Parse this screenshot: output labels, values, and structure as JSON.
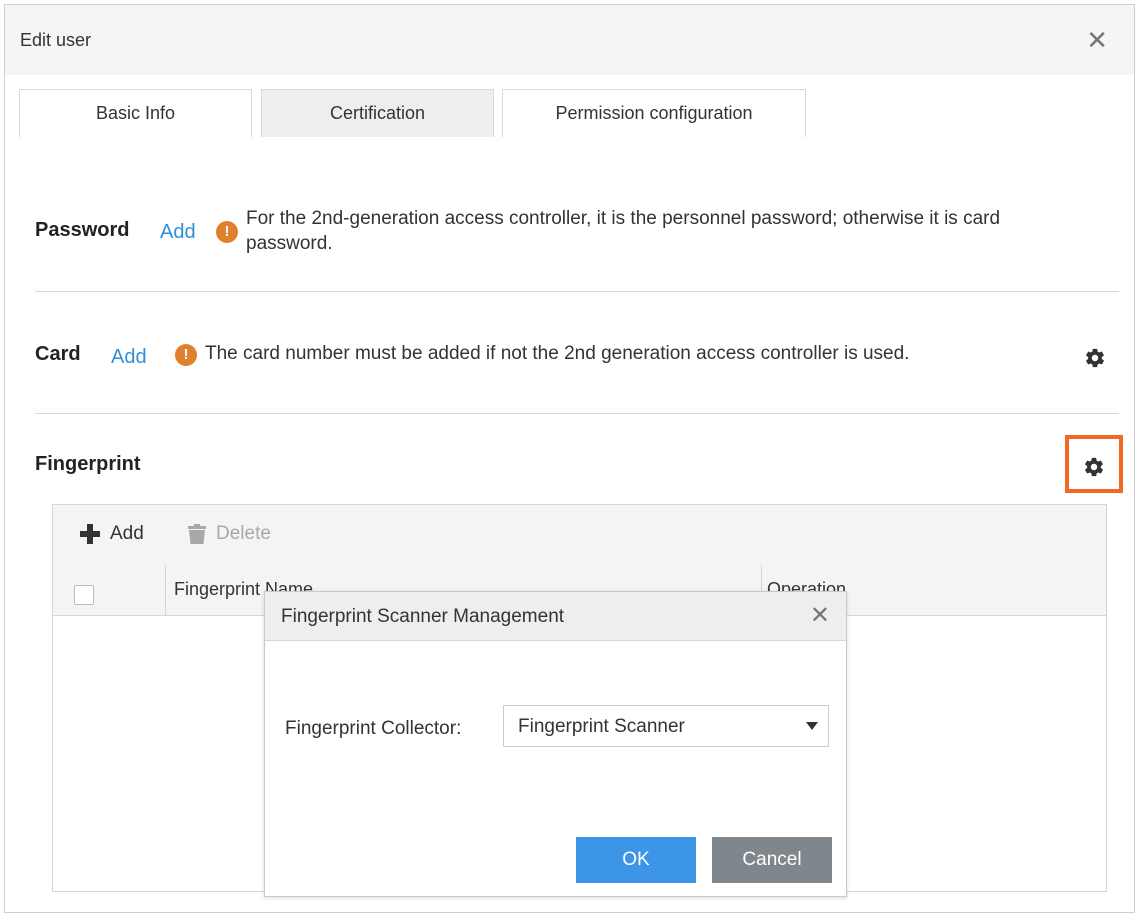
{
  "dialog": {
    "title": "Edit user",
    "close_icon": "close-icon"
  },
  "tabs": [
    {
      "label": "Basic Info",
      "active": false
    },
    {
      "label": "Certification",
      "active": true
    },
    {
      "label": "Permission configuration",
      "active": false
    }
  ],
  "password": {
    "label": "Password",
    "add_label": "Add",
    "note_line1": "For the 2nd-generation access controller, it is the personnel password; otherwise it is card",
    "note_line2": "password."
  },
  "card": {
    "label": "Card",
    "add_label": "Add",
    "note": "The card number must be added if not the 2nd generation access controller is used."
  },
  "fingerprint": {
    "label": "Fingerprint",
    "toolbar": {
      "add_label": "Add",
      "delete_label": "Delete"
    },
    "table": {
      "columns": [
        "Fingerprint Name",
        "Operation"
      ]
    }
  },
  "modal": {
    "title": "Fingerprint Scanner Management",
    "field_label": "Fingerprint Collector:",
    "selected_value": "Fingerprint Scanner",
    "ok_label": "OK",
    "cancel_label": "Cancel"
  },
  "colors": {
    "link": "#2f8fd8",
    "warning": "#e0812b",
    "highlight": "#f06a23",
    "primary_button": "#3c95e6",
    "secondary_button": "#7f868c"
  }
}
